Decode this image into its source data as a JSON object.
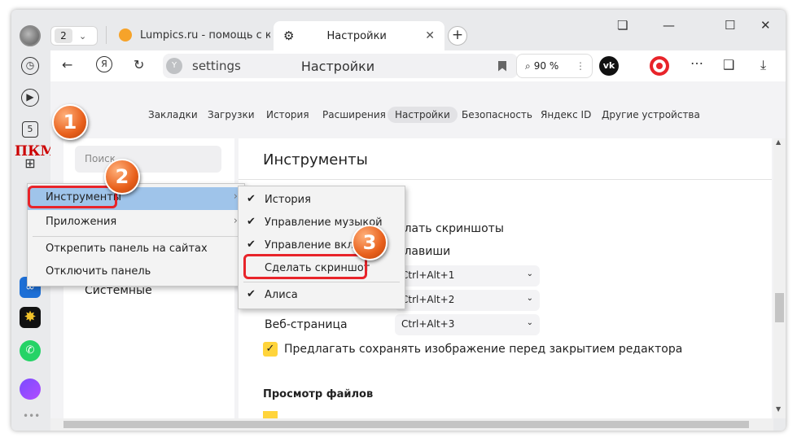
{
  "tabs": {
    "count": "2",
    "tab1_title": "Lumpics.ru - помощь с ком",
    "tab2_title": "Настройки"
  },
  "toolbar": {
    "url": "settings",
    "page_title": "Настройки",
    "zoom": "90 %"
  },
  "sidebar": {
    "pkm_label": "ПКМ",
    "apps_count": "5"
  },
  "nav": [
    "Закладки",
    "Загрузки",
    "История",
    "Расширения",
    "Настройки",
    "Безопасность",
    "Яндекс ID",
    "Другие устройства"
  ],
  "nav_active": "Настройки",
  "search": {
    "placeholder": "Поиск"
  },
  "left": {
    "item": "Системные"
  },
  "main": {
    "title": "Инструменты",
    "row1": "елать скриншоты",
    "row2": "клавиши",
    "sel1": "Ctrl+Alt+1",
    "sel2": "Ctrl+Alt+2",
    "row3": "Веб-страница",
    "sel3": "Ctrl+Alt+3",
    "checkbox": "Предлагать сохранять изображение перед закрытием редактора",
    "section2": "Просмотр файлов"
  },
  "menu1": [
    "Инструменты",
    "Приложения",
    "Открепить панель на сайтах",
    "Отключить панель"
  ],
  "menu2": [
    "История",
    "Управление музыкой",
    "Управление вклад",
    "Сделать скриншот",
    "Алиса"
  ],
  "badges": [
    "1",
    "2",
    "3"
  ],
  "colors": {
    "highlight": "#9fc4ea",
    "red": "#e8242a",
    "badge": "#e8601c",
    "check": "#ffd43b"
  }
}
